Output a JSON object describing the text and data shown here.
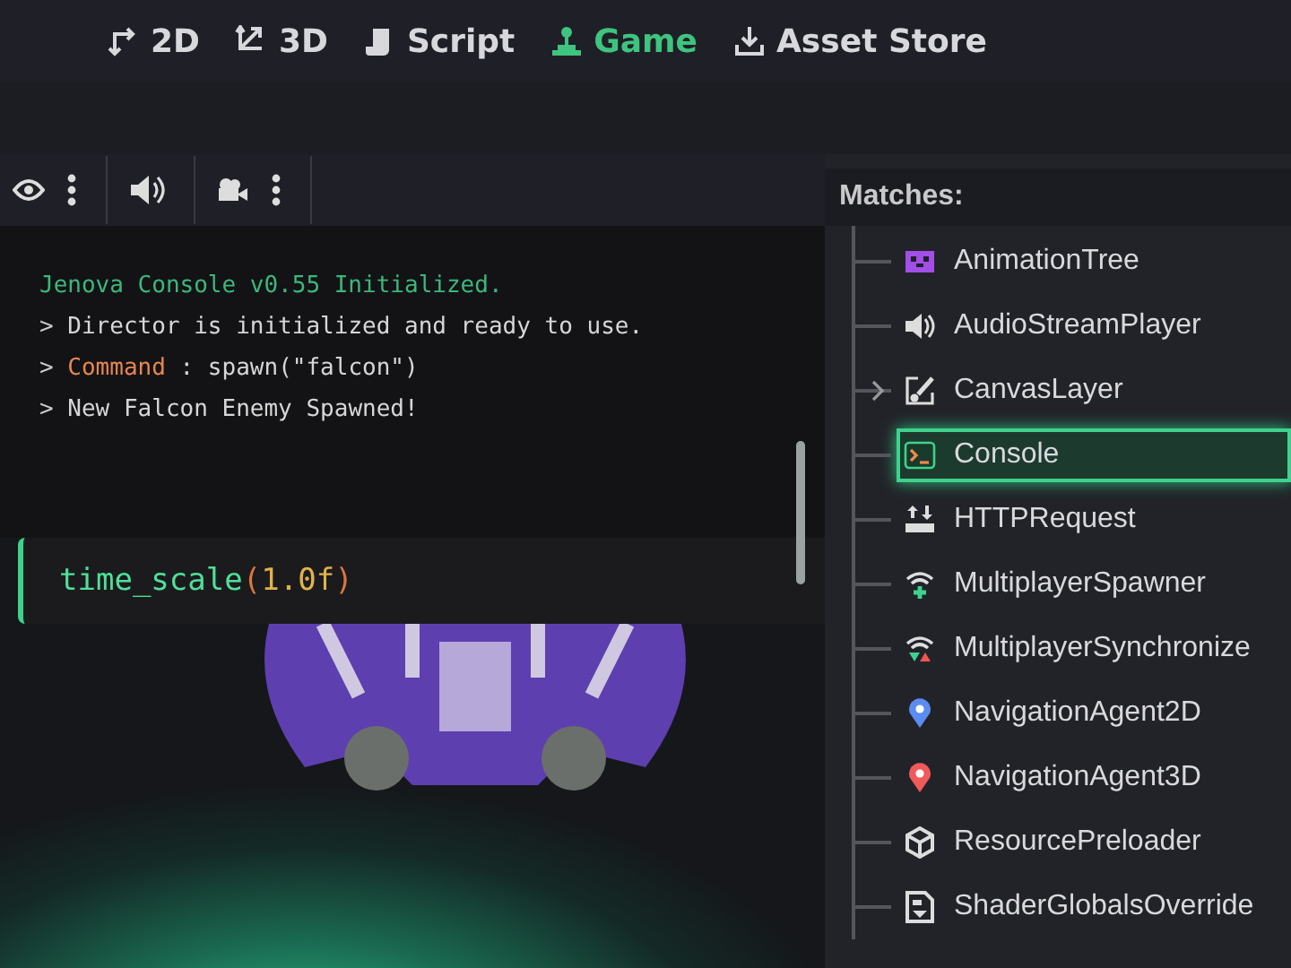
{
  "tabs": [
    {
      "label": "2D",
      "kind": "flat",
      "selected": false
    },
    {
      "label": "3D",
      "kind": "space",
      "selected": false
    },
    {
      "label": "Script",
      "kind": "script",
      "selected": false
    },
    {
      "label": "Game",
      "kind": "game",
      "selected": true
    },
    {
      "label": "Asset Store",
      "kind": "download",
      "selected": false
    }
  ],
  "toolbar": [
    {
      "kind": "eye"
    },
    {
      "kind": "more"
    },
    {
      "kind": "divider"
    },
    {
      "kind": "speaker"
    },
    {
      "kind": "divider"
    },
    {
      "kind": "camera"
    },
    {
      "kind": "more"
    },
    {
      "kind": "divider"
    }
  ],
  "console": {
    "lines": [
      {
        "parts": [
          {
            "kind": "header",
            "text": "Jenova Console v0.55 Initialized."
          }
        ]
      },
      {
        "parts": [
          {
            "kind": "prompt",
            "text": ">"
          },
          {
            "kind": "plain",
            "text": "Director is initialized and ready to use."
          }
        ]
      },
      {
        "parts": [
          {
            "kind": "prompt",
            "text": ">"
          },
          {
            "kind": "keyword",
            "text": "Command"
          },
          {
            "kind": "plain",
            "text": ": spawn(\"falcon\")"
          }
        ]
      },
      {
        "parts": [
          {
            "kind": "prompt",
            "text": ">"
          },
          {
            "kind": "plain",
            "text": "New Falcon Enemy Spawned!"
          }
        ]
      }
    ],
    "input": [
      {
        "kind": "function",
        "text": "time_scale"
      },
      {
        "kind": "paren",
        "text": "("
      },
      {
        "kind": "number",
        "text": "1.0f"
      },
      {
        "kind": "paren",
        "text": ")"
      }
    ]
  },
  "matches": {
    "title": "Matches:",
    "items": [
      {
        "label": "AnimationTree",
        "kind": "animtree",
        "expandable": false,
        "selected": false
      },
      {
        "label": "AudioStreamPlayer",
        "kind": "speaker",
        "expandable": false,
        "selected": false
      },
      {
        "label": "CanvasLayer",
        "kind": "canvas",
        "expandable": true,
        "selected": false
      },
      {
        "label": "Console",
        "kind": "console",
        "expandable": false,
        "selected": true
      },
      {
        "label": "HTTPRequest",
        "kind": "http",
        "expandable": false,
        "selected": false
      },
      {
        "label": "MultiplayerSpawner",
        "kind": "wifiplus",
        "expandable": false,
        "selected": false
      },
      {
        "label": "MultiplayerSynchronize",
        "kind": "wifisync",
        "expandable": false,
        "selected": false
      },
      {
        "label": "NavigationAgent2D",
        "kind": "bluepin",
        "expandable": false,
        "selected": false
      },
      {
        "label": "NavigationAgent3D",
        "kind": "redpin",
        "expandable": false,
        "selected": false
      },
      {
        "label": "ResourcePreloader",
        "kind": "cube",
        "expandable": false,
        "selected": false
      },
      {
        "label": "ShaderGlobalsOverride",
        "kind": "doc",
        "expandable": false,
        "selected": false
      }
    ]
  }
}
